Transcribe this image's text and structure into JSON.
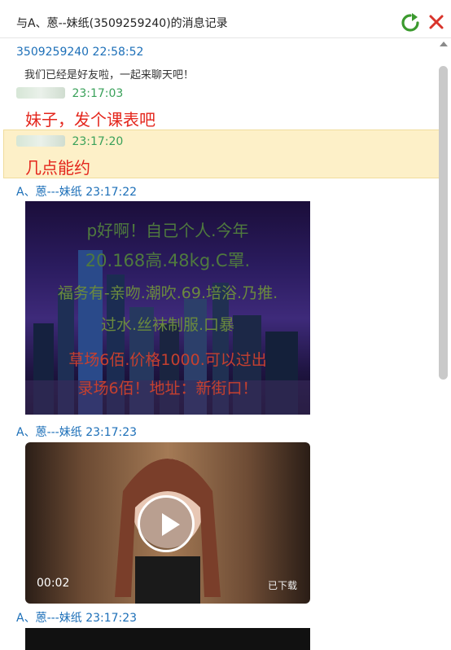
{
  "window": {
    "title": "与A、蒽--妹纸(3509259240)的消息记录",
    "refresh_icon": "refresh-icon",
    "close_icon": "close-icon"
  },
  "messages": [
    {
      "sender": "3509259240",
      "time": "22:58:52",
      "text": "我们已经是好友啦，一起来聊天吧！"
    },
    {
      "sender": "",
      "time": "23:17:03",
      "text": "妹子，发个课表吧"
    },
    {
      "sender": "",
      "time": "23:17:20",
      "text": "几点能约"
    },
    {
      "sender": "A、蒽---妹纸",
      "time": "23:17:22"
    },
    {
      "sender": "A、蒽---妹纸",
      "time": "23:17:23",
      "video_duration": "00:02",
      "video_status": "已下载"
    },
    {
      "sender": "A、蒽---妹纸",
      "time": "23:17:23"
    }
  ],
  "image_overlay": {
    "line1": "p好啊！自己个人.今年",
    "line2": "20.168高.48kg.C罩.",
    "line3": "福务有-亲吻.潮吹.69.培浴.乃推.",
    "line4": "过水.丝袜制服.口暴",
    "line5": "草场6佰.价格1000.可以过出",
    "line6": "录场6佰！地址：新街口！"
  },
  "colors": {
    "header_blue": "#1c6fb8",
    "time_green": "#3aa15a",
    "message_red": "#e4261c",
    "highlight_bg": "#fdf0c8"
  }
}
